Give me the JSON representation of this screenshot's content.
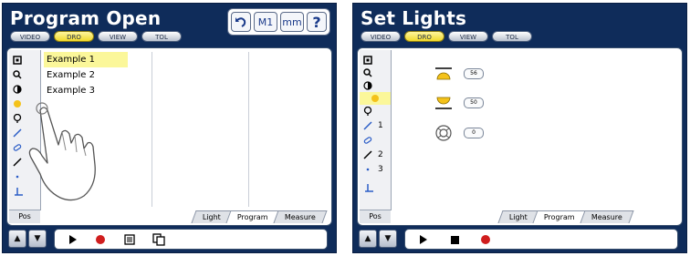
{
  "left": {
    "title": "Program Open",
    "tabs": [
      "VIDEO",
      "DRO",
      "VIEW",
      "TOL"
    ],
    "active_tab": "DRO",
    "toolbox": {
      "back_icon": "undo-arrow-icon",
      "m1_label": "M1",
      "mm_label": "mm",
      "help_label": "?"
    },
    "programs": [
      "Example 1",
      "Example 2",
      "Example 3"
    ],
    "selected_program": "Example 1",
    "pos_label": "Pos",
    "bottom_tabs": [
      "Light",
      "Program",
      "Measure"
    ],
    "active_bottom_tab": "Program",
    "controls": [
      "play-icon",
      "record-icon",
      "list-icon",
      "copy-icon"
    ],
    "overlay": "hand-pointer-icon"
  },
  "right": {
    "title": "Set Lights",
    "tabs": [
      "VIDEO",
      "DRO",
      "VIEW",
      "TOL"
    ],
    "active_tab": "DRO",
    "sidebar_numbers": [
      "1",
      "2",
      "3"
    ],
    "lights": [
      {
        "name": "top-light-icon",
        "value": "56"
      },
      {
        "name": "bottom-light-icon",
        "value": "50"
      },
      {
        "name": "ring-light-icon",
        "value": "0"
      }
    ],
    "pos_label": "Pos",
    "bottom_tabs": [
      "Light",
      "Program",
      "Measure"
    ],
    "active_bottom_tab": "Program",
    "controls": [
      "play-icon",
      "stop-icon",
      "record-icon"
    ]
  },
  "colors": {
    "panel": "#0f2c5a",
    "active_tab": "#f0d82a",
    "record": "#d01e1e",
    "selection": "#fbf79a"
  }
}
